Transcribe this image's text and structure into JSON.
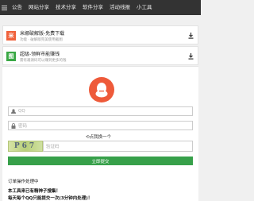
{
  "nav": {
    "items": [
      "公告",
      "网站分享",
      "技术分享",
      "软件分享",
      "活动线报",
      "小工具"
    ]
  },
  "cards": [
    {
      "badge": "米",
      "badge_color": "#f0623c",
      "title": "米娜破解版-免费下载",
      "sub": "功能 · 破解版完美使用截图"
    },
    {
      "badge": "图",
      "badge_color": "#3aa845",
      "title": "超级-领鲜市能赚钱",
      "sub": "需有邀请码可以赚到更多的钱"
    }
  ],
  "login": {
    "qq_placeholder": "QQ",
    "password_placeholder": "密码",
    "random_link": "点我换一个",
    "captcha_text": "P67",
    "captcha_placeholder": "验证码",
    "submit_label": "立即提交"
  },
  "notes": {
    "line1": "订单操作处理中",
    "line2": "本工具来已有精神子搜集！",
    "line3": "每天每个QQ只能提交一次(3分钟内处理)！"
  },
  "colors": {
    "nav_bg": "#333333",
    "submit_bg": "#37a04a",
    "avatar_bg": "#ee5a3a"
  }
}
